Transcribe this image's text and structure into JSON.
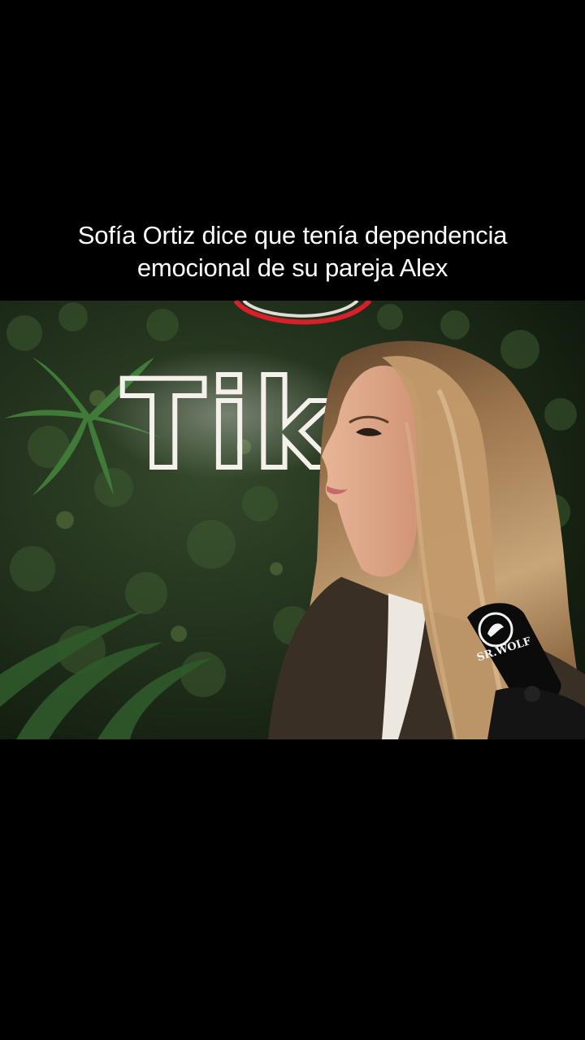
{
  "caption": {
    "line1": "Sofía Ortiz dice que tenía dependencia",
    "line2": "emocional de su pareja Alex"
  },
  "video": {
    "neon_sign_text": "TikT",
    "mic_brand": "SR.WOLF"
  },
  "colors": {
    "background": "#000000",
    "caption_text": "#ffffff",
    "foliage_dark": "#1d2a18",
    "neon_red": "#d8202a",
    "neon_white": "#f4f1ea",
    "hair": "#b58f63"
  },
  "icons": [
    "wolf-logo-icon"
  ]
}
